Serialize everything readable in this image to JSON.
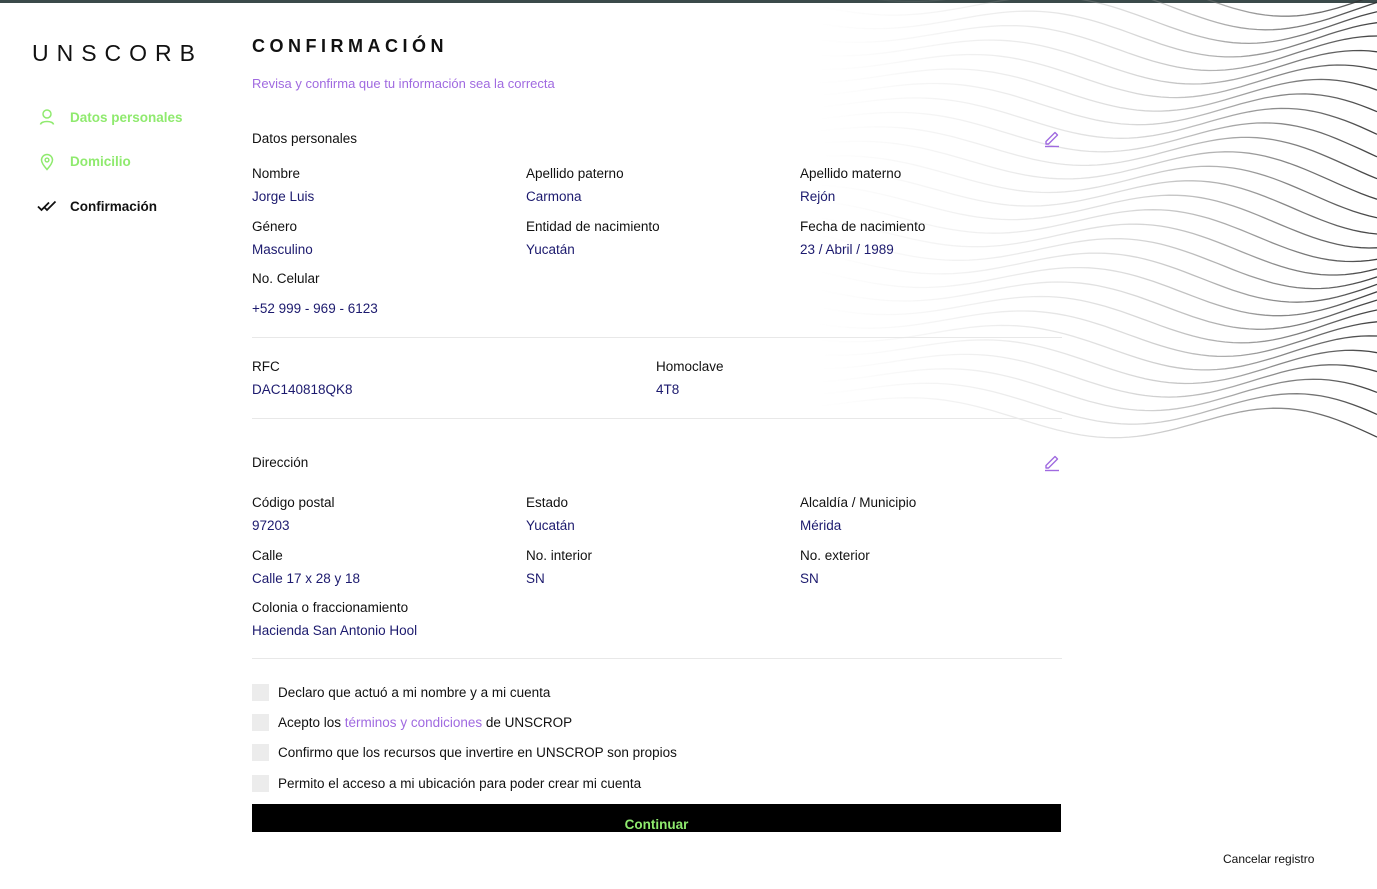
{
  "brand": {
    "logo": "UNSCORB"
  },
  "sidebar": {
    "items": [
      {
        "label": "Datos personales",
        "icon": "user-icon",
        "state": "done"
      },
      {
        "label": "Domicilio",
        "icon": "location-pin-icon",
        "state": "done"
      },
      {
        "label": "Confirmación",
        "icon": "double-check-icon",
        "state": "active"
      }
    ]
  },
  "page": {
    "title": "CONFIRMACIÓN",
    "subtitle": "Revisa y confirma que tu información sea la correcta"
  },
  "personal": {
    "section_title": "Datos personales",
    "fields": [
      {
        "label": "Nombre",
        "value": "Jorge Luis"
      },
      {
        "label": "Apellido paterno",
        "value": "Carmona"
      },
      {
        "label": "Apellido materno",
        "value": "Rejón"
      },
      {
        "label": "Género",
        "value": "Masculino"
      },
      {
        "label": "Entidad de nacimiento",
        "value": "Yucatán"
      },
      {
        "label": "Fecha de nacimiento",
        "value": "23 / Abril / 1989"
      }
    ],
    "phone": {
      "label": "No. Celular",
      "value": "+52 999 - 969 - 6123"
    }
  },
  "tax": {
    "fields": [
      {
        "label": "RFC",
        "value": "DAC140818QK8"
      },
      {
        "label": "Homoclave",
        "value": "4T8"
      }
    ]
  },
  "address": {
    "section_title": "Dirección",
    "fields": [
      {
        "label": "Código postal",
        "value": "97203"
      },
      {
        "label": "Estado",
        "value": "Yucatán"
      },
      {
        "label": "Alcaldía / Municipio",
        "value": "Mérida"
      },
      {
        "label": "Calle",
        "value": "Calle 17 x 28 y 18"
      },
      {
        "label": "No. interior",
        "value": "SN"
      },
      {
        "label": "No. exterior",
        "value": "SN"
      },
      {
        "label": "Colonia o fraccionamiento",
        "value": "Hacienda San Antonio Hool"
      }
    ]
  },
  "checks": {
    "declare": "Declaro que actuó a mi nombre y a mi cuenta",
    "terms_prefix": "Acepto los ",
    "terms_link": "términos y condiciones",
    "terms_suffix": " de UNSCROP",
    "resources": "Confirmo que los recursos que invertire en UNSCROP son propios",
    "location": "Permito el acceso a mi ubicación para poder crear mi cuenta"
  },
  "actions": {
    "continue": "Continuar",
    "cancel": "Cancelar registro"
  },
  "colors": {
    "accent_green": "#8fea6e",
    "accent_purple": "#a06ae0",
    "value_navy": "#1c1a6e",
    "button_bg": "#000000"
  }
}
